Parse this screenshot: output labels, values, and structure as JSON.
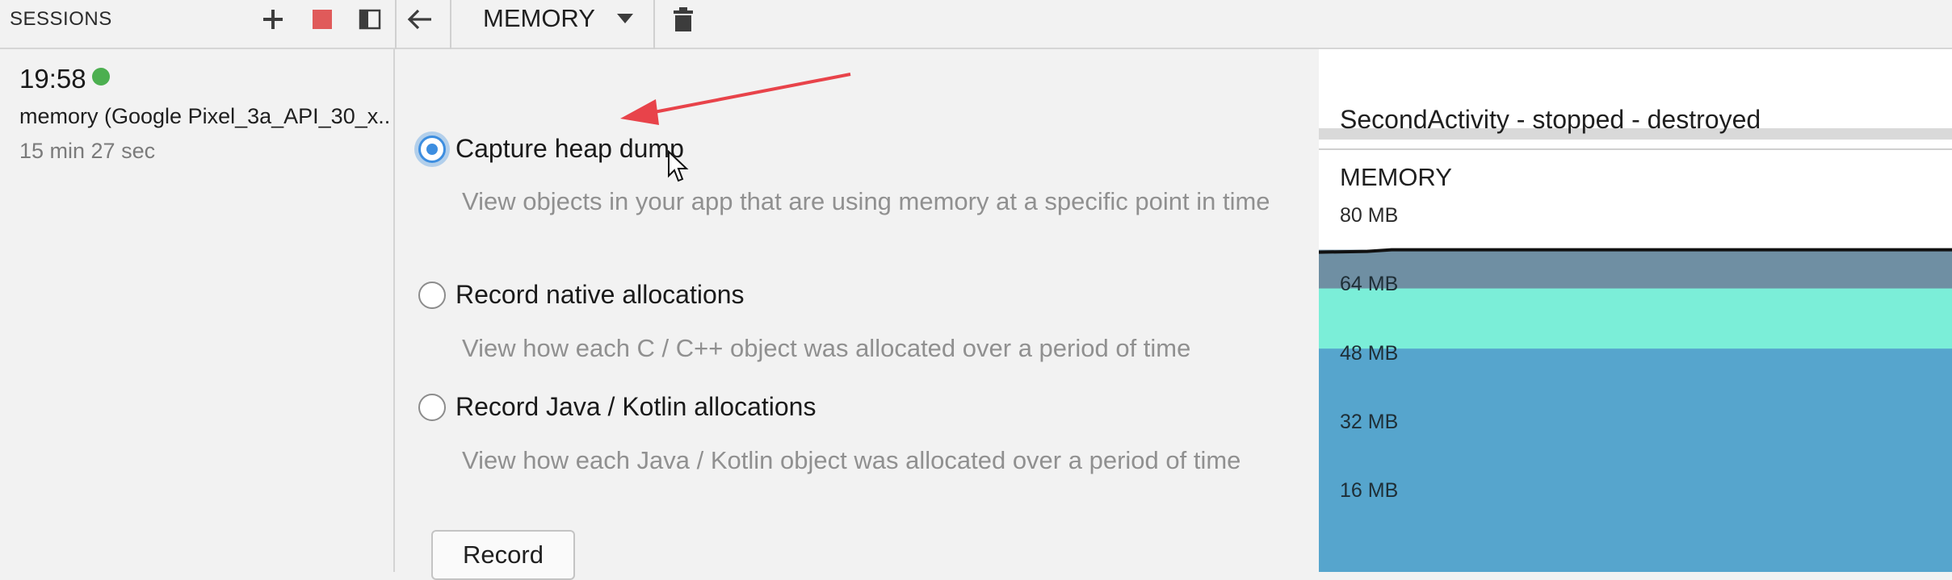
{
  "toolbar": {
    "sessions_label": "SESSIONS",
    "profiler_dropdown": "MEMORY",
    "icons": [
      "plus-icon",
      "stop-icon",
      "panel-toggle-icon",
      "back-arrow-icon",
      "dropdown-caret-icon",
      "trash-icon"
    ],
    "stop_color": "#e05a5a"
  },
  "session": {
    "time": "19:58",
    "status_color": "#4caf50",
    "name": "memory (Google Pixel_3a_API_30_x...",
    "duration": "15 min 27 sec"
  },
  "options": [
    {
      "title": "Capture heap dump",
      "description": "View objects in your app that are using memory at a specific point in time",
      "selected": true
    },
    {
      "title": "Record native allocations",
      "description": "View how each C / C++ object was allocated over a period of time",
      "selected": false
    },
    {
      "title": "Record Java / Kotlin allocations",
      "description": "View how each Java / Kotlin object was allocated over a period of time",
      "selected": false
    }
  ],
  "record_label": "Record",
  "accent_color": "#3d8ee0",
  "annotation_arrow_color": "#e8434a",
  "timeline": {
    "activity_label": "SecondActivity - stopped - destroyed",
    "memory_title": "MEMORY"
  },
  "chart_data": {
    "type": "area",
    "title": "MEMORY",
    "ylabel": "",
    "yticks": [
      "80 MB",
      "64 MB",
      "48 MB",
      "32 MB",
      "16 MB"
    ],
    "ytick_values": [
      80,
      64,
      48,
      32,
      16
    ],
    "series": [
      {
        "color": "#56a5cd",
        "values": [
          49,
          49
        ]
      },
      {
        "color": "#7beed8",
        "values": [
          63,
          63
        ]
      },
      {
        "color": "#6f8fa3",
        "values": [
          72,
          72
        ]
      }
    ],
    "grid": false
  }
}
